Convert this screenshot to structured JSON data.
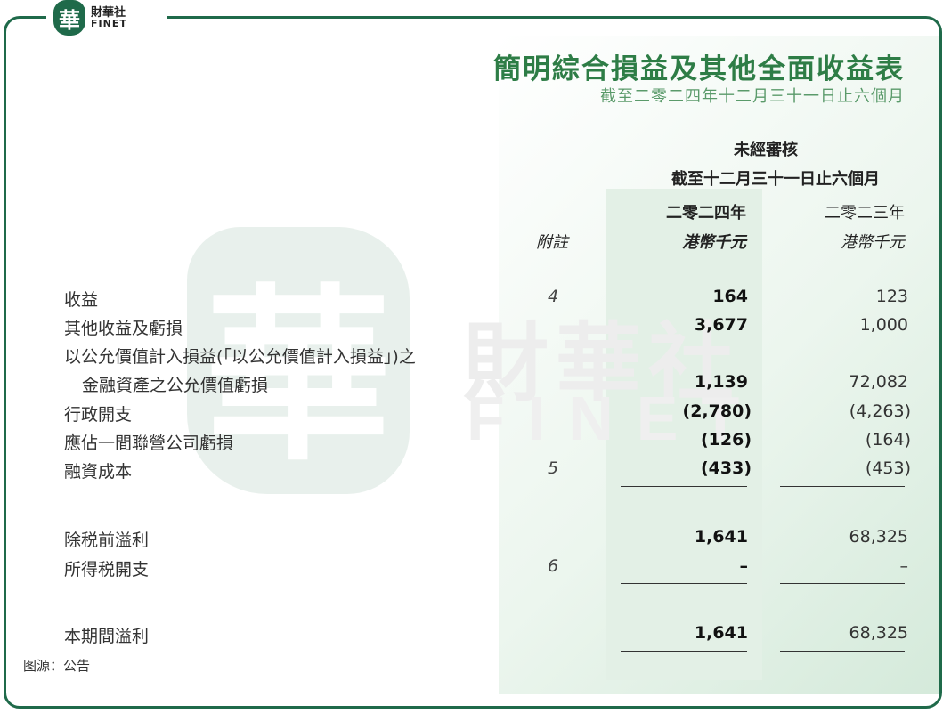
{
  "brand": {
    "seal_char": "華",
    "name_cn": "財華社",
    "name_en": "FINET"
  },
  "watermark": {
    "seal_char": "華",
    "name_cn": "財華社",
    "name_en": "FINET"
  },
  "title": "簡明綜合損益及其他全面收益表",
  "subtitle": "截至二零二四年十二月三十一日止六個月",
  "header": {
    "audit": "未經審核",
    "period": "截至十二月三十一日止六個月",
    "year_2024": "二零二四年",
    "year_2023": "二零二三年",
    "note_label": "附註",
    "unit_2024": "港幣千元",
    "unit_2023": "港幣千元"
  },
  "rows": [
    {
      "label": "收益",
      "note": "4",
      "v2024": "164",
      "v2023": "123"
    },
    {
      "label": "其他收益及虧損",
      "note": "",
      "v2024": "3,677",
      "v2023": "1,000"
    },
    {
      "label": "以公允價值計入損益(「以公允價值計入損益」)之",
      "note": "",
      "v2024": "",
      "v2023": ""
    },
    {
      "label": "金融資產之公允價值虧損",
      "note": "",
      "v2024": "1,139",
      "v2023": "72,082"
    },
    {
      "label": "行政開支",
      "note": "",
      "v2024": "(2,780)",
      "v2023": "(4,263)"
    },
    {
      "label": "應佔一間聯營公司虧損",
      "note": "",
      "v2024": "(126)",
      "v2023": "(164)"
    },
    {
      "label": "融資成本",
      "note": "5",
      "v2024": "(433)",
      "v2023": "(453)"
    },
    {
      "label": "除税前溢利",
      "note": "",
      "v2024": "1,641",
      "v2023": "68,325"
    },
    {
      "label": "所得税開支",
      "note": "6",
      "v2024": "–",
      "v2023": "–"
    },
    {
      "label": "本期間溢利",
      "note": "",
      "v2024": "1,641",
      "v2023": "68,325"
    }
  ],
  "source": "图源：公告",
  "colors": {
    "brand_green": "#1f6a4a",
    "title_green": "#2e7d46",
    "column_shade": "#e3f0e6"
  }
}
